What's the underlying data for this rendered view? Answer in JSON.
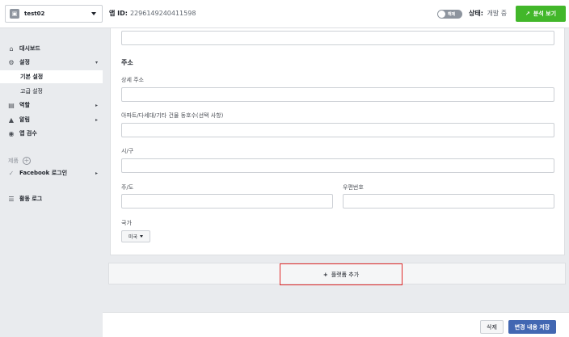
{
  "header": {
    "app_name": "test02",
    "app_id_label": "앱 ID:",
    "app_id_value": "2296149240411598",
    "toggle_label": "해제",
    "status_label": "상태:",
    "status_value": "개발 중",
    "analytics_button": "분석 보기"
  },
  "sidebar": {
    "dashboard": "대시보드",
    "settings": "설정",
    "basic_settings": "기본 설정",
    "advanced_settings": "고급 설정",
    "roles": "역할",
    "alerts": "알림",
    "app_review": "앱 검수",
    "products": "제품",
    "facebook_login": "Facebook 로그인",
    "activity_log": "활동 로그"
  },
  "form": {
    "address_section": "주소",
    "street_address_label": "상세 주소",
    "apt_label": "아파트/다세대/기타 건물 동호수(선택 사항)",
    "city_label": "시/구",
    "state_label": "주/도",
    "zip_label": "우편번호",
    "country_label": "국가",
    "country_value": "미국"
  },
  "platform": {
    "add_platform": "플랫폼 추가"
  },
  "footer": {
    "delete": "삭제",
    "save": "변경 내용 저장"
  }
}
